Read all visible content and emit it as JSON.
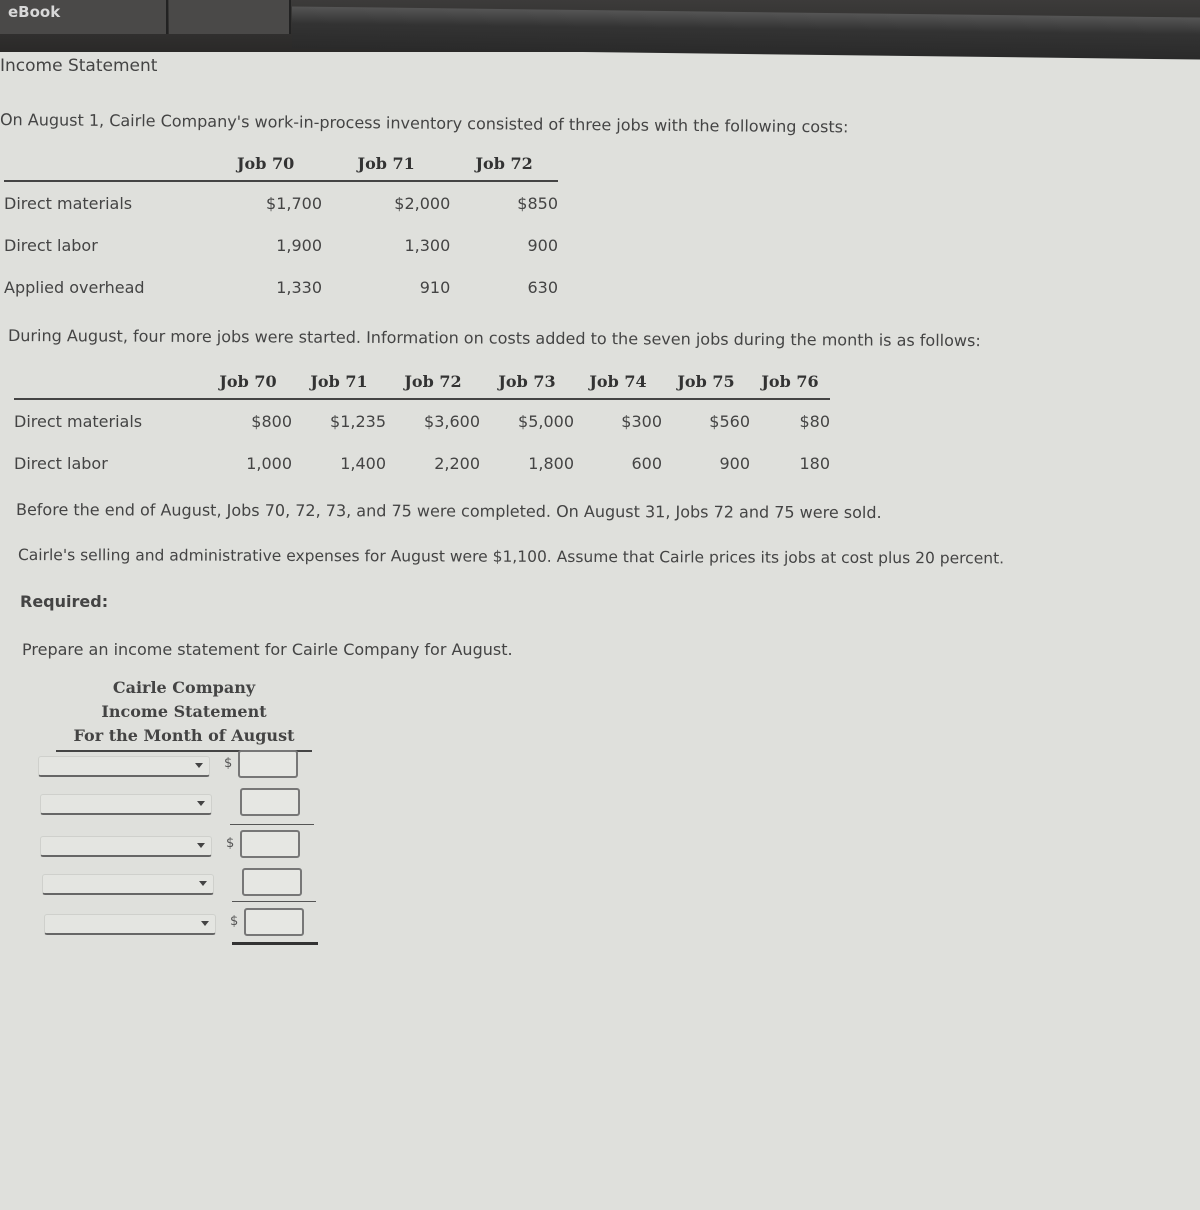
{
  "tabs": [
    {
      "label": "eBook"
    },
    {
      "label": ""
    }
  ],
  "section_title": "Income Statement",
  "intro": "On August 1, Cairle Company's work-in-process inventory consisted of three jobs with the following costs:",
  "table1": {
    "headers": [
      "",
      "Job 70",
      "Job 71",
      "Job 72"
    ],
    "rows": [
      {
        "label": "Direct materials",
        "values": [
          "$1,700",
          "$2,000",
          "$850"
        ]
      },
      {
        "label": "Direct labor",
        "values": [
          "1,900",
          "1,300",
          "900"
        ]
      },
      {
        "label": "Applied overhead",
        "values": [
          "1,330",
          "910",
          "630"
        ]
      }
    ]
  },
  "during": "During August, four more jobs were started. Information on costs added to the seven jobs during the month is as follows:",
  "table2": {
    "headers": [
      "",
      "Job 70",
      "Job 71",
      "Job 72",
      "Job 73",
      "Job 74",
      "Job 75",
      "Job 76"
    ],
    "rows": [
      {
        "label": "Direct materials",
        "values": [
          "$800",
          "$1,235",
          "$3,600",
          "$5,000",
          "$300",
          "$560",
          "$80"
        ]
      },
      {
        "label": "Direct labor",
        "values": [
          "1,000",
          "1,400",
          "2,200",
          "1,800",
          "600",
          "900",
          "180"
        ]
      }
    ]
  },
  "completed": "Before the end of August, Jobs 70, 72, 73, and 75 were completed. On August 31, Jobs 72 and 75 were sold.",
  "selling": "Cairle's selling and administrative expenses for August were $1,100. Assume that Cairle prices its jobs at cost plus 20 percent.",
  "required_label": "Required:",
  "prepare": "Prepare an income statement for Cairle Company for August.",
  "statement": {
    "company": "Cairle Company",
    "title": "Income Statement",
    "period": "For the Month of August",
    "currency_symbol": "$",
    "rows": [
      {
        "select_value": "",
        "amount": "",
        "show_dollar": true
      },
      {
        "select_value": "",
        "amount": "",
        "show_dollar": false
      },
      {
        "select_value": "",
        "amount": "",
        "show_dollar": true
      },
      {
        "select_value": "",
        "amount": "",
        "show_dollar": false
      },
      {
        "select_value": "",
        "amount": "",
        "show_dollar": true
      }
    ]
  }
}
